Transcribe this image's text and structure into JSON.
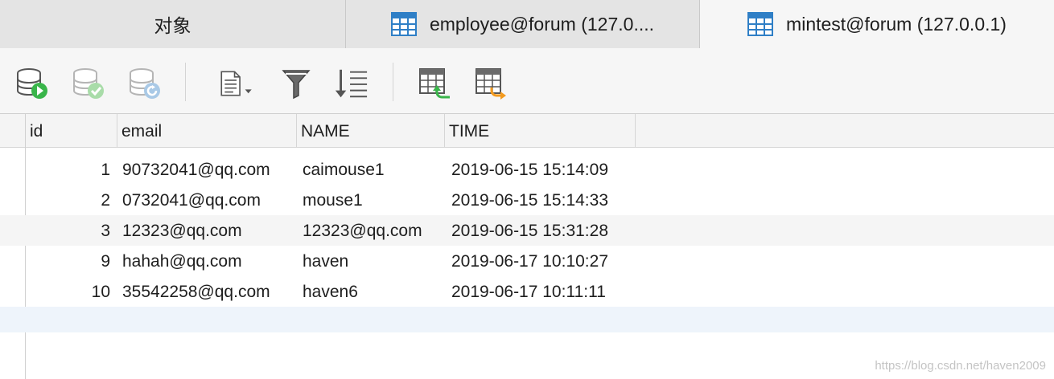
{
  "tabs": [
    {
      "label": "对象",
      "icon": null,
      "active": false
    },
    {
      "label": "employee@forum (127.0....",
      "icon": "table-icon",
      "active": false
    },
    {
      "label": "mintest@forum (127.0.0.1)",
      "icon": "table-icon",
      "active": true
    }
  ],
  "toolbar": {
    "buttons": [
      {
        "name": "begin-transaction-icon",
        "enabled": true
      },
      {
        "name": "commit-icon",
        "enabled": false
      },
      {
        "name": "rollback-icon",
        "enabled": false
      },
      {
        "name": "text-view-icon",
        "enabled": true
      },
      {
        "name": "filter-icon",
        "enabled": true
      },
      {
        "name": "sort-icon",
        "enabled": true
      },
      {
        "name": "import-icon",
        "enabled": true
      },
      {
        "name": "export-icon",
        "enabled": true
      }
    ]
  },
  "table": {
    "columns": [
      "id",
      "email",
      "NAME",
      "TIME"
    ],
    "rows": [
      [
        "1",
        "90732041@qq.com",
        "caimouse1",
        "2019-06-15 15:14:09"
      ],
      [
        "2",
        "0732041@qq.com",
        "mouse1",
        "2019-06-15 15:14:33"
      ],
      [
        "3",
        "12323@qq.com",
        "12323@qq.com",
        "2019-06-15 15:31:28"
      ],
      [
        "9",
        "hahah@qq.com",
        "haven",
        "2019-06-17 10:10:27"
      ],
      [
        "10",
        "35542258@qq.com",
        "haven6",
        "2019-06-17 10:11:11"
      ]
    ]
  },
  "watermark": "https://blog.csdn.net/haven2009",
  "colors": {
    "tabbar_bg": "#e4e4e4",
    "active_tab_bg": "#f6f6f6",
    "table_icon_blue": "#2f7fc6",
    "green_accent": "#39b54a",
    "orange_accent": "#f39a1e",
    "alt_row_bg": "#f5f5f5",
    "new_row_bg": "#eef4fb"
  }
}
